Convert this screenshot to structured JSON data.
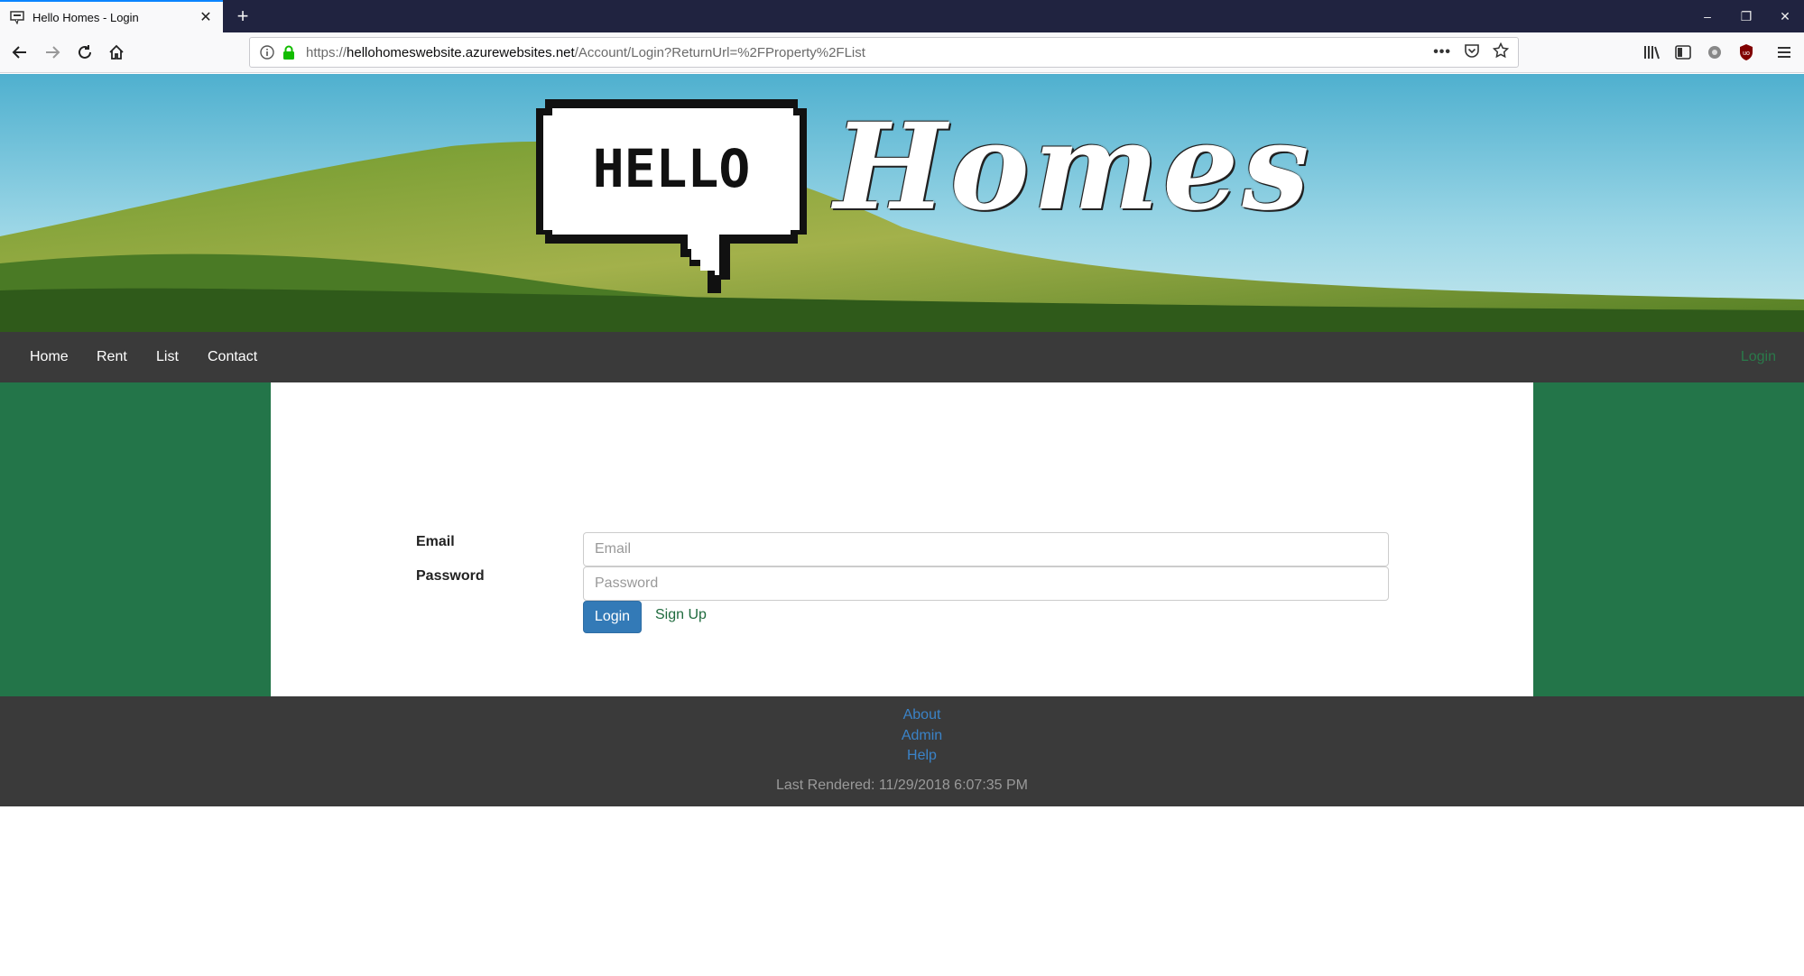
{
  "browser": {
    "tab_title": "Hello Homes - Login",
    "url_host": "hellohomeswebsite.azurewebsites.net",
    "url_prefix": "https://",
    "url_path": "/Account/Login?ReturnUrl=%2FProperty%2FList",
    "icons": [
      "back-icon",
      "forward-icon",
      "reload-icon",
      "home-icon",
      "info-icon",
      "lock-icon",
      "more-icon",
      "pocket-icon",
      "star-icon",
      "library-icon",
      "sidebar-icon",
      "extension-icon",
      "ublock-icon",
      "menu-icon"
    ]
  },
  "banner": {
    "logo_bubble": "HELLO",
    "logo_script": "Homes"
  },
  "nav": {
    "items": [
      {
        "label": "Home"
      },
      {
        "label": "Rent"
      },
      {
        "label": "List"
      },
      {
        "label": "Contact"
      }
    ],
    "login": "Login"
  },
  "form": {
    "email_label": "Email",
    "email_placeholder": "Email",
    "password_label": "Password",
    "password_placeholder": "Password",
    "login_button": "Login",
    "signup_link": "Sign Up"
  },
  "footer": {
    "links": [
      {
        "label": "About"
      },
      {
        "label": "Admin"
      },
      {
        "label": "Help"
      }
    ],
    "last_rendered": "Last Rendered: 11/29/2018 6:07:35 PM"
  },
  "colors": {
    "accent_green": "#237549",
    "nav_bg": "#3a3a3a",
    "button_blue": "#337ab7",
    "link_blue": "#3a83c8"
  }
}
